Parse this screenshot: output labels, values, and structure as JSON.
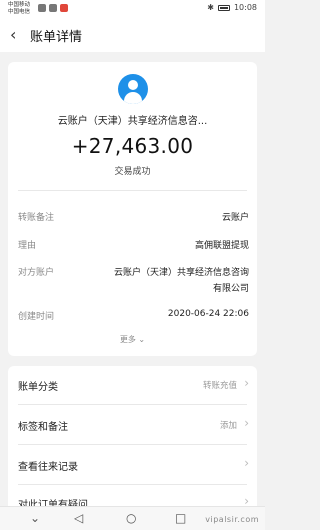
{
  "statusbar": {
    "carrier1": "中国移动",
    "carrier2": "中国电信",
    "time": "10:08"
  },
  "nav": {
    "title": "账单详情"
  },
  "transaction": {
    "account_name": "云账户（天津）共享经济信息咨...",
    "amount": "+27,463.00",
    "status": "交易成功"
  },
  "details": {
    "remark_label": "转账备注",
    "remark_value": "云账户",
    "reason_label": "理由",
    "reason_value": "高佣联盟提现",
    "counterparty_label": "对方账户",
    "counterparty_line1": "云账户（天津）共享经济信息咨询",
    "counterparty_line2": "有限公司",
    "created_label": "创建时间",
    "created_value": "2020-06-24 22:06",
    "more_label": "更多"
  },
  "list": {
    "category_label": "账单分类",
    "category_value": "转账充值",
    "tags_label": "标签和备注",
    "tags_value": "添加",
    "history_label": "查看往来记录",
    "partial_label": "对此订单有疑问"
  },
  "watermark": "vipalsir.com",
  "icons": {
    "back": "back-arrow-icon",
    "avatar": "user-avatar-icon",
    "chevron": "chevron-right-icon",
    "more": "chevron-down-icon"
  }
}
